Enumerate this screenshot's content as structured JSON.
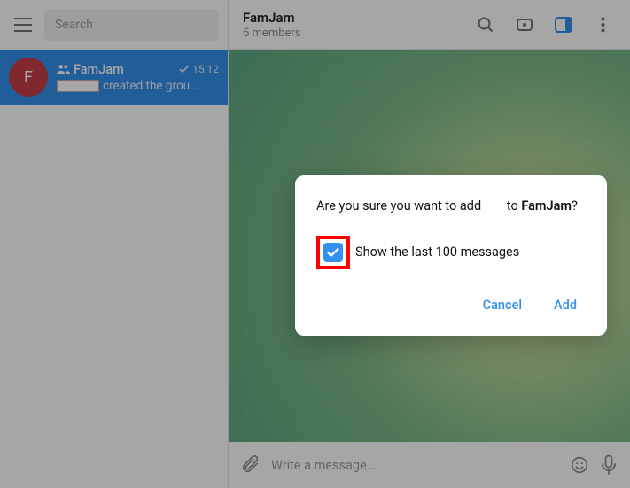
{
  "sidebar": {
    "search_placeholder": "Search",
    "chat": {
      "avatar_letter": "F",
      "name": "FamJam",
      "time": "15:12",
      "preview": "created the grou…"
    }
  },
  "header": {
    "title": "FamJam",
    "subtitle": "5 members"
  },
  "composer": {
    "placeholder": "Write a message..."
  },
  "modal": {
    "text_prefix": "Are you sure you want to add ",
    "text_middle": " to ",
    "group_name": "FamJam",
    "text_suffix": "?",
    "checkbox_label": "Show the last 100 messages",
    "cancel_label": "Cancel",
    "add_label": "Add"
  }
}
